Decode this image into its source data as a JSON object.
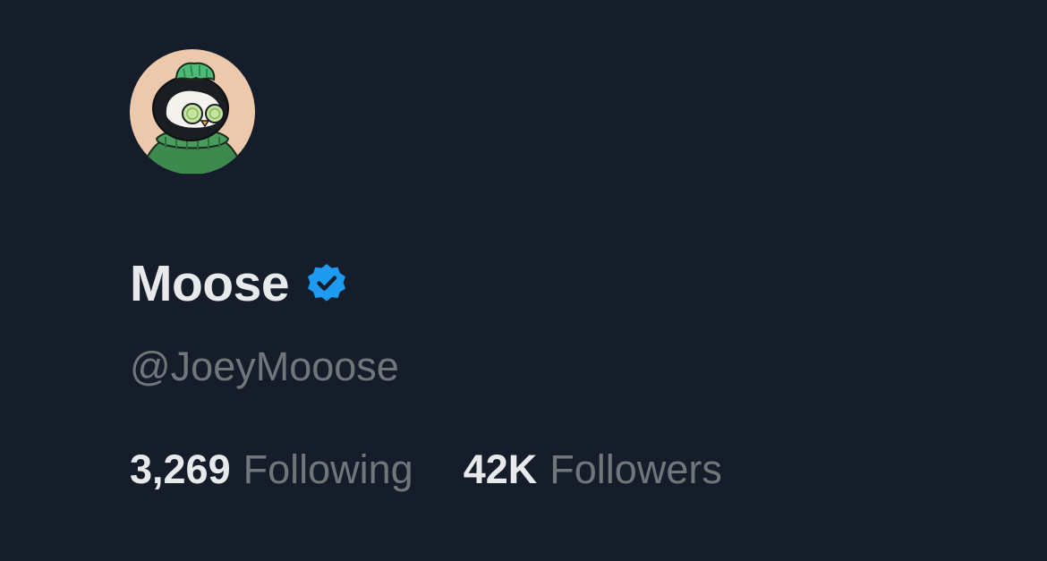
{
  "profile": {
    "display_name": "Moose",
    "handle": "@JoeyMooose",
    "verified": true,
    "avatar_icon": "penguin-avatar-icon",
    "badge_icon": "verified-checkmark-icon",
    "stats": {
      "following_count": "3,269",
      "following_label": "Following",
      "followers_count": "42K",
      "followers_label": "Followers"
    }
  },
  "colors": {
    "background": "#151d2a",
    "primary_text": "#e7e9ea",
    "secondary_text": "#71767b",
    "verified_blue": "#1d9bf0",
    "avatar_bg": "#ecc9ac",
    "sweater_green": "#3f8e53",
    "hair_green": "#4fba78"
  }
}
